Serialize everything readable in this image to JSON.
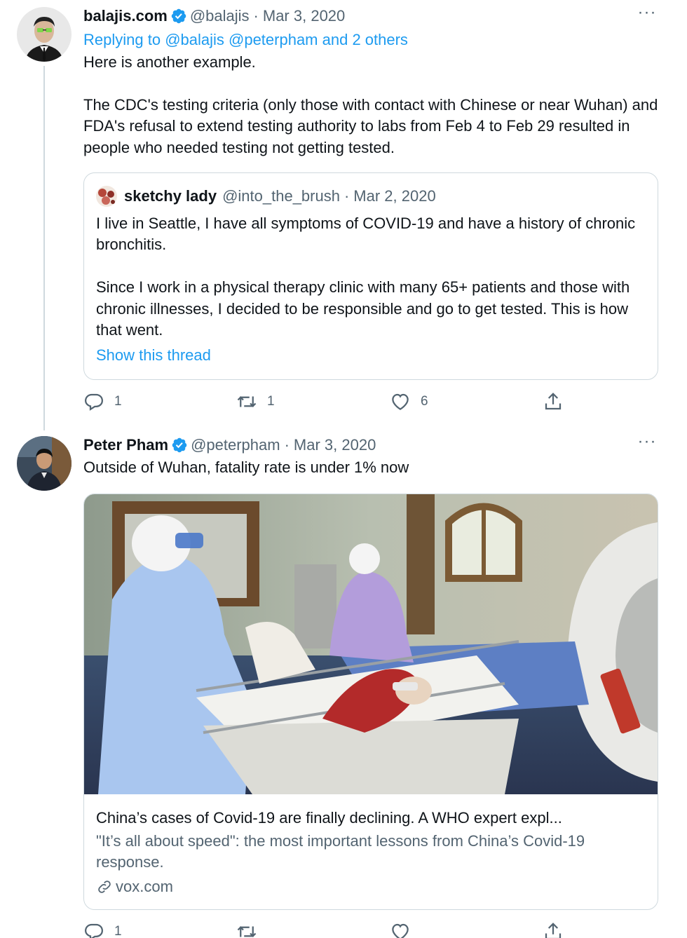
{
  "tweets": [
    {
      "author_name": "balajis.com",
      "handle": "@balajis",
      "separator": "·",
      "date": "Mar 3, 2020",
      "more": "···",
      "replying_prefix": "Replying to ",
      "replying_users": "@balajis @peterpham and 2 others",
      "text": "Here is another example.\n\nThe CDC's testing criteria (only those with contact with Chinese or near Wuhan) and FDA's refusal to extend testing authority to labs from Feb 4 to Feb 29 resulted in people who needed testing not getting tested.",
      "quote": {
        "author_name": "sketchy lady",
        "handle": "@into_the_brush",
        "separator": "·",
        "date": "Mar 2, 2020",
        "text": "I live in Seattle, I have all symptoms of COVID-19 and have a history of chronic bronchitis.\n\nSince I work in a physical therapy clinic with many 65+ patients and those with chronic illnesses, I decided to be responsible and go to get tested. This is how that went.",
        "show_thread": "Show this thread"
      },
      "actions": {
        "replies": "1",
        "retweets": "1",
        "likes": "6"
      }
    },
    {
      "author_name": "Peter Pham",
      "handle": "@peterpham",
      "separator": "·",
      "date": "Mar 3, 2020",
      "more": "···",
      "text": "Outside of Wuhan, fatality rate is under 1% now",
      "card": {
        "title": "China’s cases of Covid-19 are finally declining. A WHO expert expl...",
        "description": "\"It’s all about speed\": the most important lessons from China’s Covid-19 response.",
        "domain": "vox.com"
      },
      "actions": {
        "replies": "1",
        "retweets": "",
        "likes": ""
      }
    }
  ],
  "colors": {
    "link": "#1d9bf0",
    "secondary": "#536471",
    "border": "#cfd9de",
    "text": "#0f1419"
  },
  "icons": [
    "verified-badge-icon",
    "more-icon",
    "reply-icon",
    "retweet-icon",
    "like-icon",
    "share-icon",
    "link-icon"
  ]
}
